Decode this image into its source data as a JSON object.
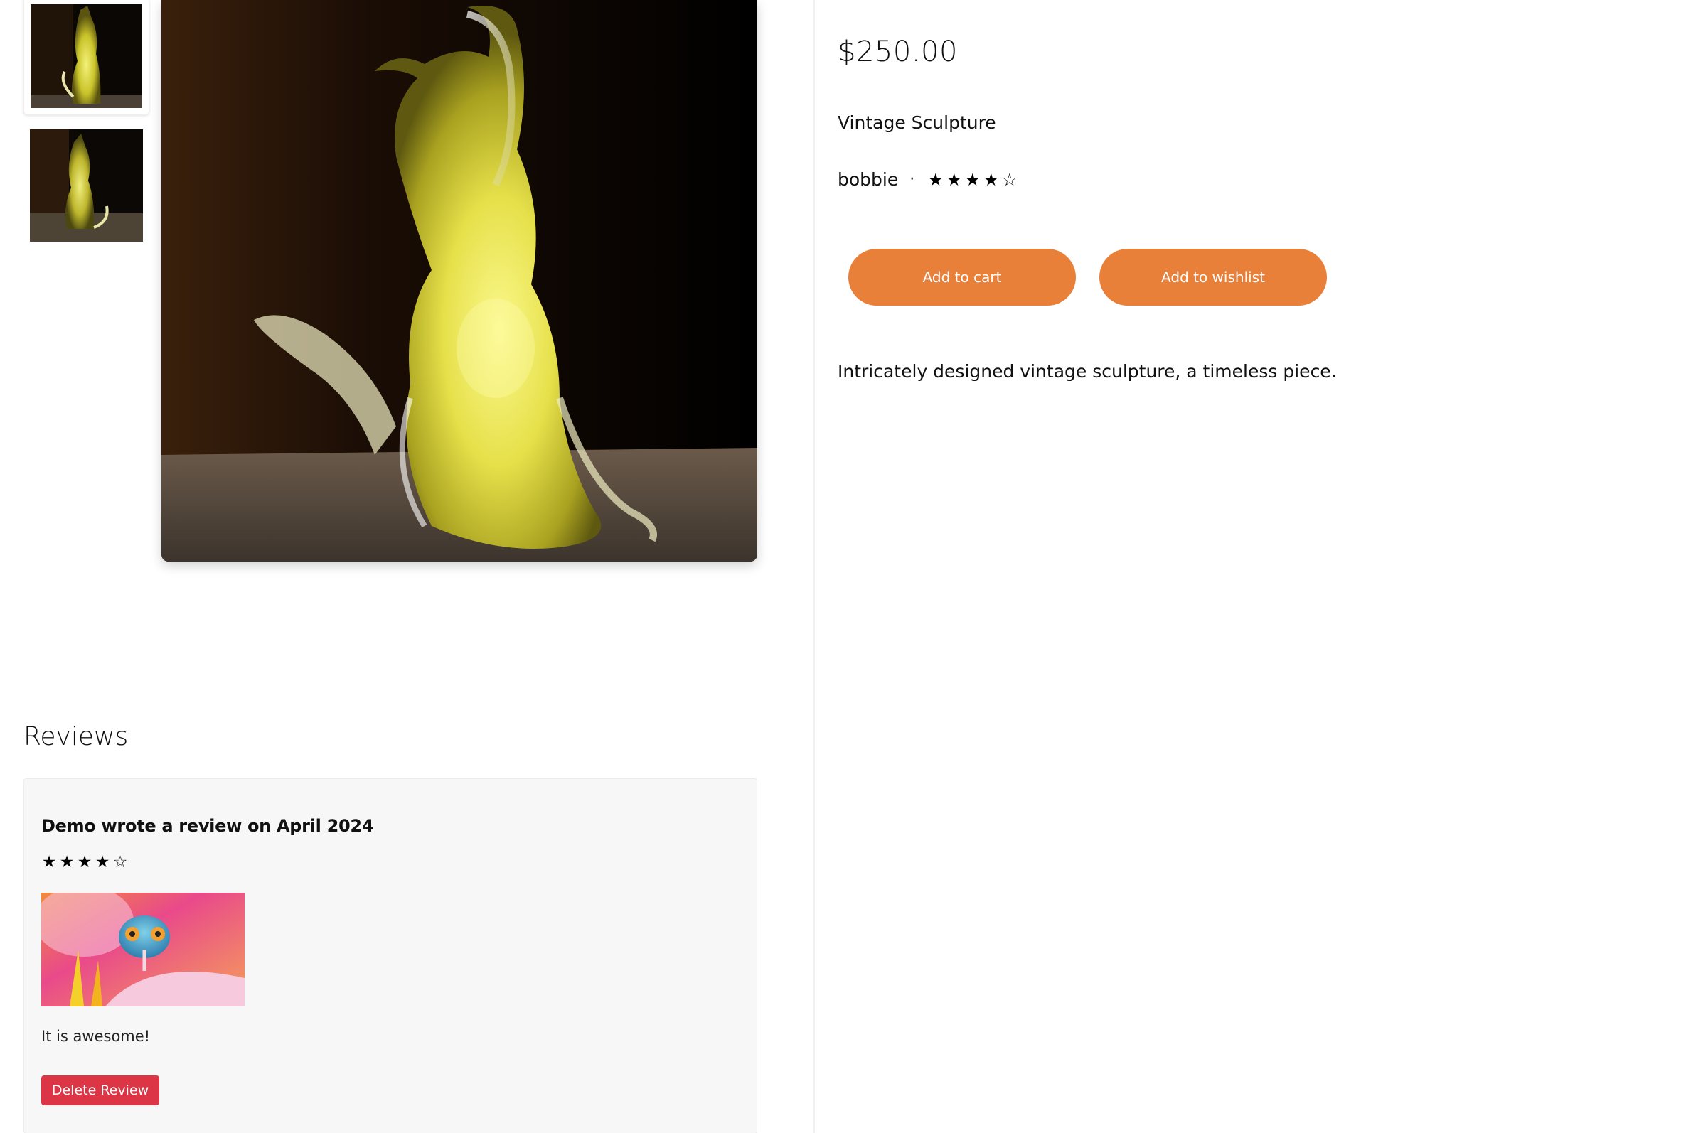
{
  "product": {
    "price": "$250.00",
    "title": "Vintage Sculpture",
    "seller": "bobbie",
    "separator": "·",
    "rating": {
      "filled": 4,
      "total": 5
    },
    "description": "Intricately designed vintage sculpture, a timeless piece."
  },
  "gallery": {
    "thumbnails": [
      {
        "icon": "glass-cat-thumbnail",
        "active": true
      },
      {
        "icon": "glass-cat-thumbnail",
        "active": false
      }
    ],
    "main_image": "glass-cat-sculpture"
  },
  "actions": {
    "add_to_cart": "Add to cart",
    "add_to_wishlist": "Add to wishlist"
  },
  "reviews": {
    "heading": "Reviews",
    "items": [
      {
        "title": "Demo wrote a review on April 2024",
        "rating": {
          "filled": 4,
          "total": 5
        },
        "photo": "chameleon-on-flower",
        "text": "It is awesome!",
        "delete_label": "Delete Review"
      }
    ]
  },
  "colors": {
    "accent": "#e8803a",
    "danger": "#dc3545",
    "card_bg": "#f7f7f7"
  }
}
